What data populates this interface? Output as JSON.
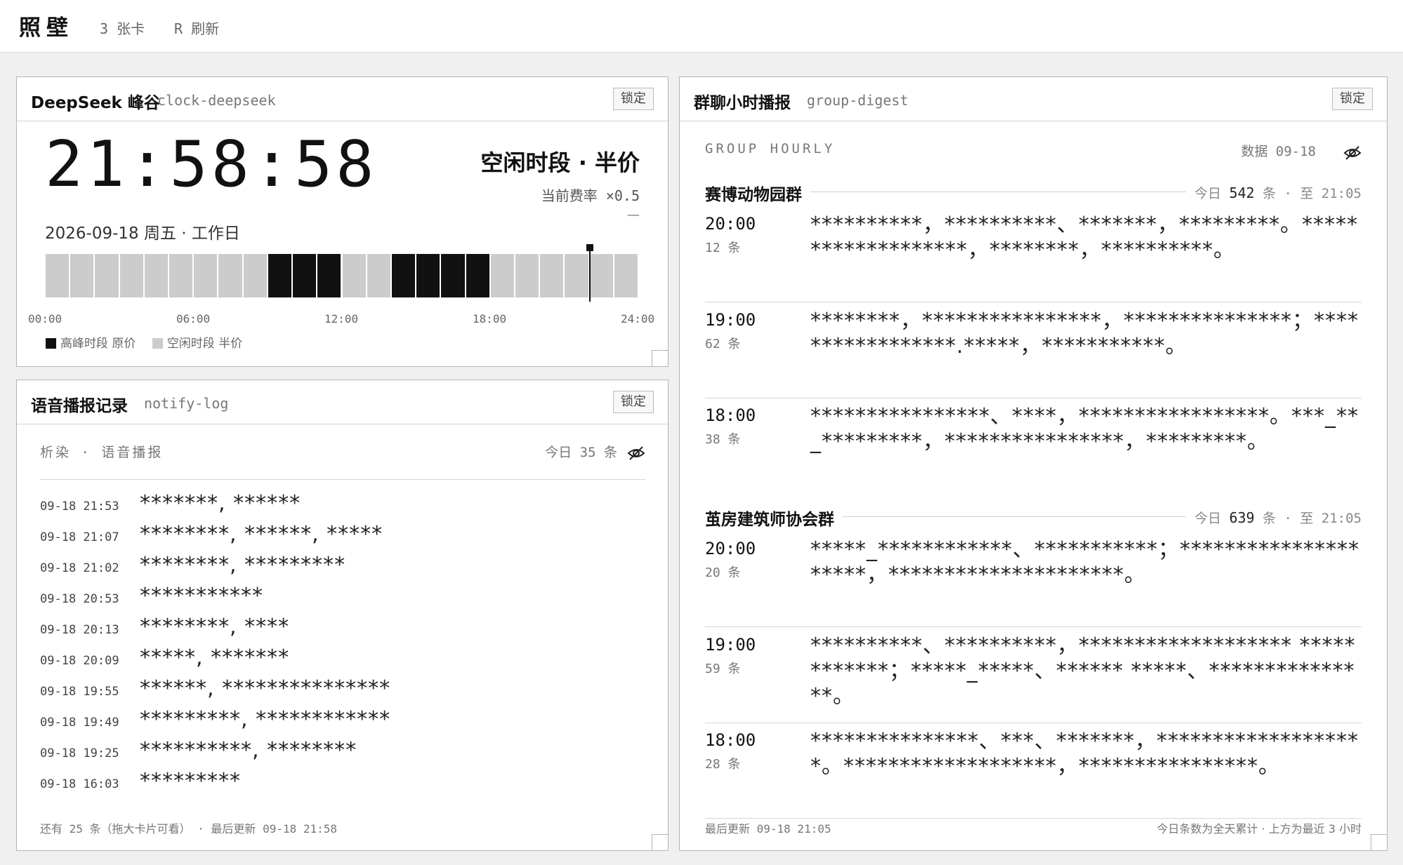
{
  "app": {
    "title": "照壁",
    "card_count_hint": "3 张卡",
    "refresh_hint": "R 刷新"
  },
  "clock_card": {
    "title": "DeepSeek 峰谷",
    "id": "clock-deepseek",
    "lock_label": "锁定",
    "time": "21:58:58",
    "date": "2026-09-18 周五 · 工作日",
    "period": "空闲时段 · 半价",
    "rate": "当前费率 ×0.5",
    "rate_sub": "—",
    "hour_bands": [
      "off",
      "off",
      "off",
      "off",
      "off",
      "off",
      "off",
      "off",
      "off",
      "peak",
      "peak",
      "peak",
      "off",
      "off",
      "peak",
      "peak",
      "peak",
      "peak",
      "off",
      "off",
      "off",
      "off",
      "off",
      "off"
    ],
    "current_hour_fraction": 0.9159,
    "ticks": [
      "00:00",
      "06:00",
      "12:00",
      "18:00",
      "24:00"
    ],
    "legend_peak": "高峰时段 原价",
    "legend_off": "空闲时段 半价",
    "colors": {
      "peak": "#111111",
      "off": "#cccccc"
    }
  },
  "log_card": {
    "title": "语音播报记录",
    "id": "notify-log",
    "lock_label": "锁定",
    "subtitle": "析染 · 语音播报",
    "today_count": "今日 35 条",
    "rows": [
      {
        "time": "09-18 21:53",
        "text": "*******, ******"
      },
      {
        "time": "09-18 21:07",
        "text": "********, ******, *****"
      },
      {
        "time": "09-18 21:02",
        "text": "********, *********"
      },
      {
        "time": "09-18 20:53",
        "text": "***********"
      },
      {
        "time": "09-18 20:13",
        "text": "********, ****"
      },
      {
        "time": "09-18 20:09",
        "text": "*****, *******"
      },
      {
        "time": "09-18 19:55",
        "text": "******, ***************"
      },
      {
        "time": "09-18 19:49",
        "text": "*********, ************"
      },
      {
        "time": "09-18 19:25",
        "text": "**********, ********"
      },
      {
        "time": "09-18 16:03",
        "text": "*********"
      }
    ],
    "footer": "还有 25 条（拖大卡片可看） · 最后更新 09-18 21:58"
  },
  "digest_card": {
    "title": "群聊小时播报",
    "id": "group-digest",
    "lock_label": "锁定",
    "subtitle": "GROUP HOURLY",
    "data_date": "数据 09-18",
    "groups": [
      {
        "name": "赛博动物园群",
        "today_label": "今日",
        "count": "542",
        "count_unit": "条 · 至 21:05",
        "entries": [
          {
            "hour": "20:00",
            "count": "12 条",
            "text": "**********，**********、*******，*********。*******************，********，**********。"
          },
          {
            "hour": "19:00",
            "count": "62 条",
            "text": "********，****************，***************；*****************.*****，***********。"
          },
          {
            "hour": "18:00",
            "count": "38 条",
            "text": "****************、****，*****************。***_**_*********，****************，*********。"
          }
        ]
      },
      {
        "name": "茧房建筑师协会群",
        "today_label": "今日",
        "count": "639",
        "count_unit": "条 · 至 21:05",
        "entries": [
          {
            "hour": "20:00",
            "count": "20 条",
            "text": "*****_************、***********；*********************，*********************。"
          },
          {
            "hour": "19:00",
            "count": "59 条",
            "text": "**********、**********，******************* ************；*****_*****、****** *****、***************。"
          },
          {
            "hour": "18:00",
            "count": "28 条",
            "text": "***************、***、*******，*******************。*******************，****************。"
          }
        ]
      }
    ],
    "footer_left": "最后更新 09-18 21:05",
    "footer_right": "今日条数为全天累计 · 上方为最近 3 小时"
  }
}
